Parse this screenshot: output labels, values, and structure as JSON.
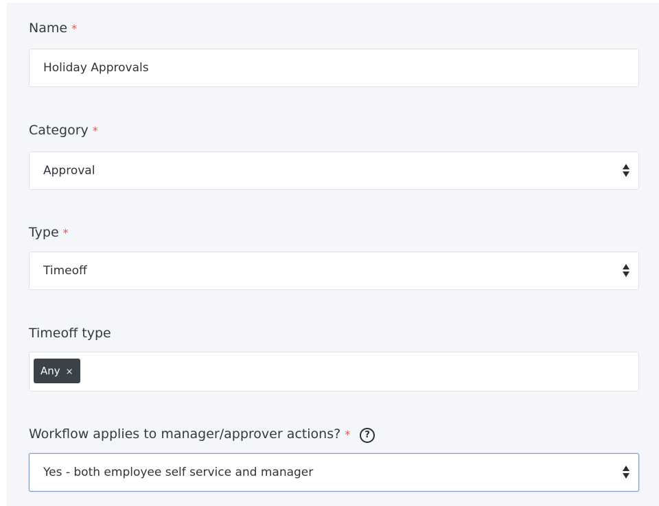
{
  "form": {
    "name": {
      "label": "Name",
      "required_mark": "*",
      "value": "Holiday Approvals"
    },
    "category": {
      "label": "Category",
      "required_mark": "*",
      "value": "Approval"
    },
    "type": {
      "label": "Type",
      "required_mark": "*",
      "value": "Timeoff"
    },
    "timeoff_type": {
      "label": "Timeoff type",
      "tags": [
        "Any"
      ],
      "tag_remove": "×"
    },
    "applies_to": {
      "label": "Workflow applies to manager/approver actions?",
      "required_mark": "*",
      "help": "?",
      "value": "Yes - both employee self service and manager"
    }
  },
  "colors": {
    "required": "#e5544f",
    "tag_background": "#3b4248",
    "focus_border": "#7f9fc4"
  }
}
